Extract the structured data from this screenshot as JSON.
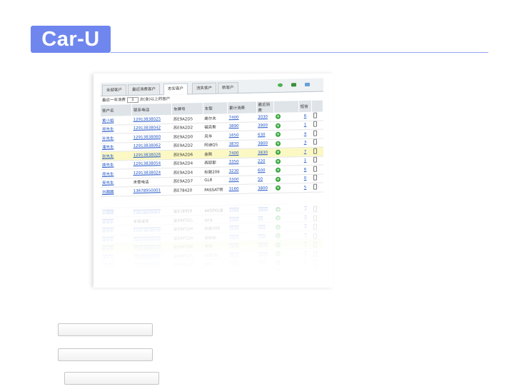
{
  "brand": {
    "logo_text": "Car-U"
  },
  "colors": {
    "brand": "#6f86ee",
    "highlight_row": "#fbf8c4",
    "link": "#2457c8",
    "ok_green": "#35a43a"
  },
  "screenshot": {
    "tabs": [
      {
        "label": "全部客户",
        "active": false
      },
      {
        "label": "最近消费客户",
        "active": false
      },
      {
        "label": "忠实客户",
        "active": true
      },
      {
        "label": "流失客户",
        "active": false
      },
      {
        "label": "新客户",
        "active": false
      }
    ],
    "toolbar_icons": [
      "refresh-icon",
      "mail-icon",
      "export-icon"
    ],
    "filter": {
      "prefix": "最近一年消费",
      "value": "3",
      "suffix": "次(含)以上的客户"
    },
    "columns": [
      "客户名",
      "联系电话",
      "车牌号",
      "车型",
      "累计消费",
      "最近消费",
      "",
      "短信",
      ""
    ],
    "rows": [
      {
        "name": "黄小姐",
        "phone": "12913838025",
        "plate": "苏E9A2D5",
        "model": "高尔夫",
        "total": "7400",
        "recent": "3030",
        "sms": "6",
        "highlight": false
      },
      {
        "name": "郑先生",
        "phone": "12913838042",
        "plate": "苏E9A2D2",
        "model": "福克斯",
        "total": "3890",
        "recent": "3900",
        "sms": "1",
        "highlight": false
      },
      {
        "name": "孙先生",
        "phone": "12913838060",
        "plate": "苏E9A2D0",
        "model": "风华",
        "total": "1650",
        "recent": "630",
        "sms": "4",
        "highlight": false
      },
      {
        "name": "潘先生",
        "phone": "12913838062",
        "plate": "苏E9A2D2",
        "model": "阿迪Q5",
        "total": "3870",
        "recent": "3800",
        "sms": "3",
        "highlight": false
      },
      {
        "name": "张先生",
        "phone": "12913838026",
        "plate": "苏E9A2D6",
        "model": "金刚",
        "total": "7400",
        "recent": "3830",
        "sms": "7",
        "highlight": true
      },
      {
        "name": "唐先生",
        "phone": "12913838054",
        "plate": "苏E9A2D4",
        "model": "西耶那",
        "total": "3350",
        "recent": "220",
        "sms": "1",
        "highlight": false
      },
      {
        "name": "周先生",
        "phone": "12913838024",
        "plate": "苏E9A2D4",
        "model": "标致206",
        "total": "3230",
        "recent": "600",
        "sms": "6",
        "highlight": false
      },
      {
        "name": "吴先生",
        "phone": "未登电话",
        "plate": "苏E9A2D7",
        "model": "GL8",
        "total": "3300",
        "recent": "50",
        "sms": "0",
        "highlight": false
      },
      {
        "name": "刘圆圆",
        "phone": "13678950001",
        "plate": "苏E78420",
        "model": "PASSAT领",
        "total": "3160",
        "recent": "3800",
        "sms": "5",
        "highlight": false
      }
    ]
  }
}
